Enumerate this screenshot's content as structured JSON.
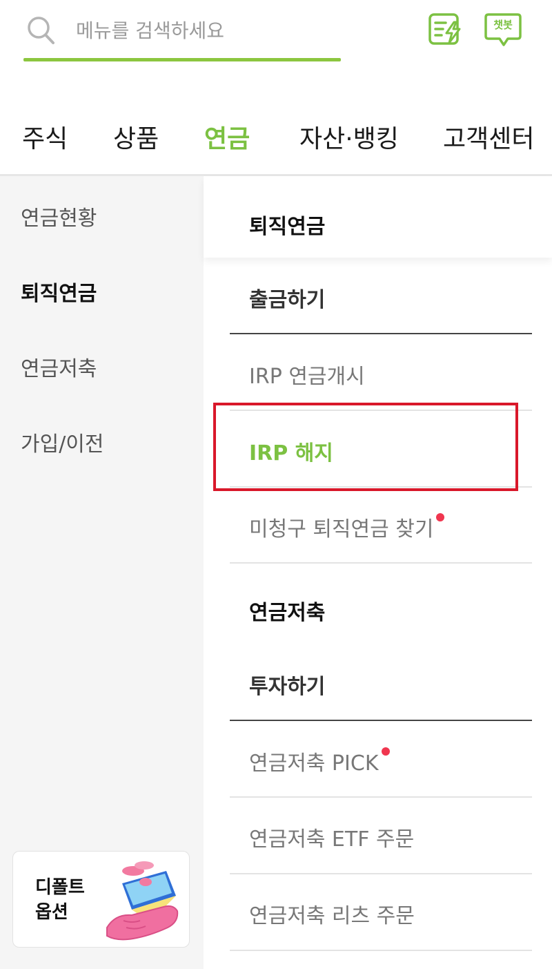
{
  "search": {
    "placeholder": "메뉴를 검색하세요",
    "value": ""
  },
  "top_icons": {
    "chatbot_label": "챗봇"
  },
  "tabs": [
    {
      "label": "주식",
      "active": false
    },
    {
      "label": "상품",
      "active": false
    },
    {
      "label": "연금",
      "active": true
    },
    {
      "label": "자산·뱅킹",
      "active": false
    },
    {
      "label": "고객센터",
      "active": false
    }
  ],
  "sidebar": {
    "items": [
      {
        "label": "연금현황",
        "active": false
      },
      {
        "label": "퇴직연금",
        "active": true
      },
      {
        "label": "연금저축",
        "active": false
      },
      {
        "label": "가입/이전",
        "active": false
      }
    ],
    "promo": {
      "line1": "디폴트",
      "line2": "옵션"
    }
  },
  "panel": {
    "section1": {
      "title": "퇴직연금",
      "subhead": "출금하기",
      "links": [
        "IRP 연금개시",
        "IRP 해지",
        "미청구 퇴직연금 찾기"
      ]
    },
    "section2": {
      "title": "연금저축",
      "subhead": "투자하기",
      "links": [
        "연금저축 PICK",
        "연금저축 ETF 주문",
        "연금저축 리츠 주문"
      ]
    }
  },
  "colors": {
    "accent_green": "#7cc142",
    "underline_green": "#8cc63f",
    "new_dot": "#f0364f",
    "highlight_red": "#d9182a"
  }
}
